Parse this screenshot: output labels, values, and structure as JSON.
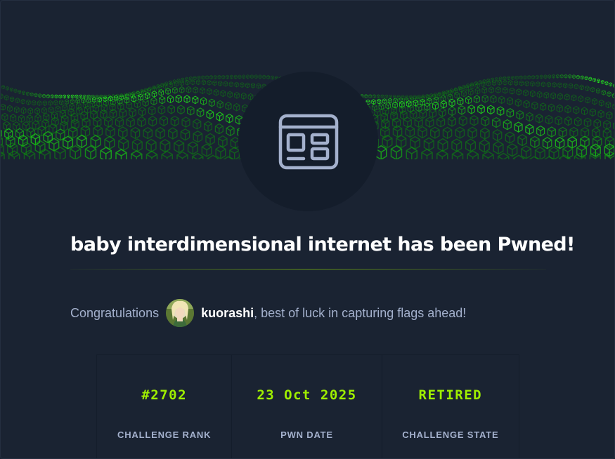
{
  "title": "baby interdimensional internet has been Pwned!",
  "congrats": {
    "prefix": "Congratulations",
    "username": "kuorashi",
    "suffix": ", best of luck in capturing flags ahead!"
  },
  "stats": [
    {
      "value": "#2702",
      "label": "CHALLENGE RANK"
    },
    {
      "value": "23 Oct 2025",
      "label": "PWN DATE"
    },
    {
      "value": "RETIRED",
      "label": "CHALLENGE STATE"
    }
  ],
  "icons": {
    "challenge": "web-browser-window-icon",
    "user": "user-avatar"
  },
  "colors": {
    "background": "#1a2332",
    "accent": "#9fef00",
    "muted_text": "#a4b1cd",
    "icon": "#a4b1cd",
    "circle": "#141d2b"
  }
}
